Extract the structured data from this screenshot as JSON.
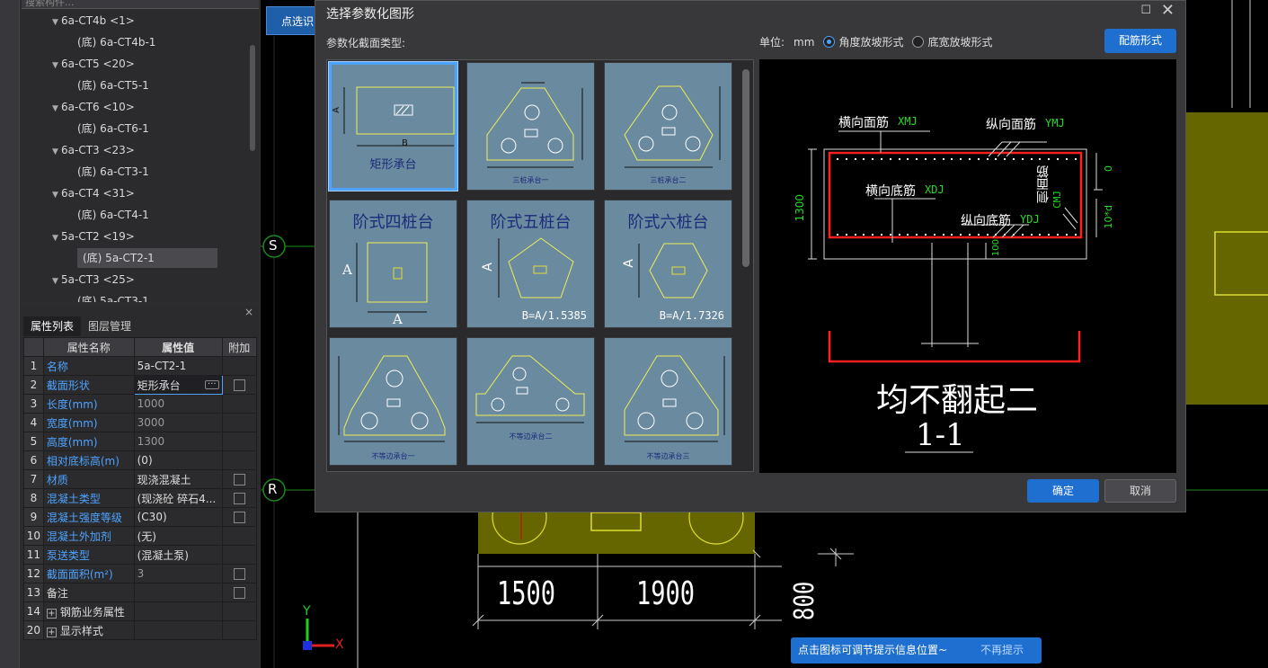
{
  "tree": {
    "search_placeholder": "搜索构件...",
    "items": [
      {
        "label": "6a-CT4b <1>",
        "child": false
      },
      {
        "label": "(底) 6a-CT4b-1",
        "child": true
      },
      {
        "label": "6a-CT5 <20>",
        "child": false
      },
      {
        "label": "(底) 6a-CT5-1",
        "child": true
      },
      {
        "label": "6a-CT6 <10>",
        "child": false
      },
      {
        "label": "(底) 6a-CT6-1",
        "child": true
      },
      {
        "label": "6a-CT3 <23>",
        "child": false
      },
      {
        "label": "(底) 6a-CT3-1",
        "child": true
      },
      {
        "label": "6a-CT4 <31>",
        "child": false
      },
      {
        "label": "(底) 6a-CT4-1",
        "child": true
      },
      {
        "label": "5a-CT2 <19>",
        "child": false
      },
      {
        "label": "(底) 5a-CT2-1",
        "child": true,
        "selected": true
      },
      {
        "label": "5a-CT3 <25>",
        "child": false
      },
      {
        "label": "(底) 5a-CT3-1",
        "child": true
      }
    ]
  },
  "props": {
    "tabs": [
      "属性列表",
      "图层管理"
    ],
    "headers": [
      "属性名称",
      "属性值",
      "附加"
    ],
    "close_label": "×",
    "rows": [
      {
        "num": "1",
        "name": "名称",
        "value": "5a-CT2-1",
        "check": false,
        "blue": true
      },
      {
        "num": "2",
        "name": "截面形状",
        "value": "矩形承台",
        "check": true,
        "blue": true,
        "dots": "···"
      },
      {
        "num": "3",
        "name": "长度(mm)",
        "value": "1000",
        "check": false,
        "blue": true,
        "gray": true
      },
      {
        "num": "4",
        "name": "宽度(mm)",
        "value": "3000",
        "check": false,
        "blue": true,
        "gray": true
      },
      {
        "num": "5",
        "name": "高度(mm)",
        "value": "1300",
        "check": false,
        "blue": true,
        "gray": true
      },
      {
        "num": "6",
        "name": "相对底标高(m)",
        "value": "(0)",
        "check": false,
        "blue": true
      },
      {
        "num": "7",
        "name": "材质",
        "value": "现浇混凝土",
        "check": true,
        "blue": true
      },
      {
        "num": "8",
        "name": "混凝土类型",
        "value": "(现浇砼 碎石4...",
        "check": true,
        "blue": true
      },
      {
        "num": "9",
        "name": "混凝土强度等级",
        "value": "(C30)",
        "check": true,
        "blue": true
      },
      {
        "num": "10",
        "name": "混凝土外加剂",
        "value": "(无)",
        "check": false,
        "blue": true
      },
      {
        "num": "11",
        "name": "泵送类型",
        "value": "(混凝土泵)",
        "check": false,
        "blue": true
      },
      {
        "num": "12",
        "name": "截面面积(m²)",
        "value": "3",
        "check": true,
        "blue": true,
        "gray": true
      },
      {
        "num": "13",
        "name": "备注",
        "value": "",
        "check": true,
        "blue": false
      },
      {
        "num": "14",
        "name": "钢筋业务属性",
        "value": "",
        "check": false,
        "blue": false,
        "plus": "+"
      },
      {
        "num": "20",
        "name": "显示样式",
        "value": "",
        "check": false,
        "blue": false,
        "plus": "+"
      }
    ]
  },
  "pick_button": "点选识",
  "axis": {
    "s": "S",
    "r": "R",
    "x": "X",
    "y": "Y"
  },
  "dims": {
    "d1": "1500",
    "d2": "1900",
    "d3": "800"
  },
  "dialog": {
    "title": "选择参数化图形",
    "max_icon": "☐",
    "close_icon": "✕",
    "section_label": "参数化截面类型:",
    "unit_label": "单位:",
    "unit_value": "mm",
    "radio1": "角度放坡形式",
    "radio2": "底宽放坡形式",
    "rebar_button": "配筋形式",
    "ok": "确定",
    "cancel": "取消",
    "tiles": [
      {
        "title": "矩形承台",
        "dimA": "A",
        "dimB": "B"
      },
      {
        "sub": "三桩承台一"
      },
      {
        "sub": "三桩承台二"
      },
      {
        "title": "阶式四桩台",
        "dimA": "A",
        "dimB": "A"
      },
      {
        "title": "阶式五桩台",
        "dimA": "A",
        "foot": "B=A/1.5385"
      },
      {
        "title": "阶式六桩台",
        "dimA": "A",
        "foot": "B=A/1.7326"
      },
      {
        "sub": "不等边承台一"
      },
      {
        "sub": "不等边承台二"
      },
      {
        "sub": "不等边承台三"
      }
    ],
    "preview": {
      "xmj_cn": "横向面筋",
      "xmj": "XMJ",
      "ymj_cn": "纵向面筋",
      "ymj": "YMJ",
      "xdj_cn": "横向底筋",
      "xdj": "XDJ",
      "ydj_cn": "纵向底筋",
      "ydj": "YDJ",
      "cmj_cn": "侧面筋",
      "cmj": "CMJ",
      "h": "1300",
      "zero": "0",
      "tend": "10*d",
      "hundred": "100",
      "caption": "均不翻起二",
      "section": "1-1"
    }
  },
  "tip": {
    "text": "点击图标可调节提示信息位置~",
    "dismiss": "不再提示"
  }
}
